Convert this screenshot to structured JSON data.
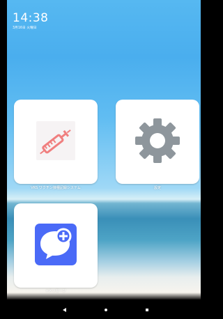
{
  "status_bar": {
    "time": "14:38",
    "date": "3月16日 火曜日"
  },
  "apps": [
    {
      "label": "VRS ワクチン接種記録システム",
      "icon": "syringe-icon"
    },
    {
      "label": "設定",
      "icon": "gear-icon"
    },
    {
      "label": "+メッセージ",
      "icon": "message-plus-icon"
    }
  ],
  "navigation": {
    "back_icon": "back-icon",
    "home_icon": "home-icon",
    "recent_icon": "recent-apps-icon"
  },
  "colors": {
    "sky": "#4aaeee",
    "syringe": "#f07f7f",
    "gear": "#8e969c",
    "message_accent": "#4a6af7",
    "tile": "#ffffff"
  }
}
